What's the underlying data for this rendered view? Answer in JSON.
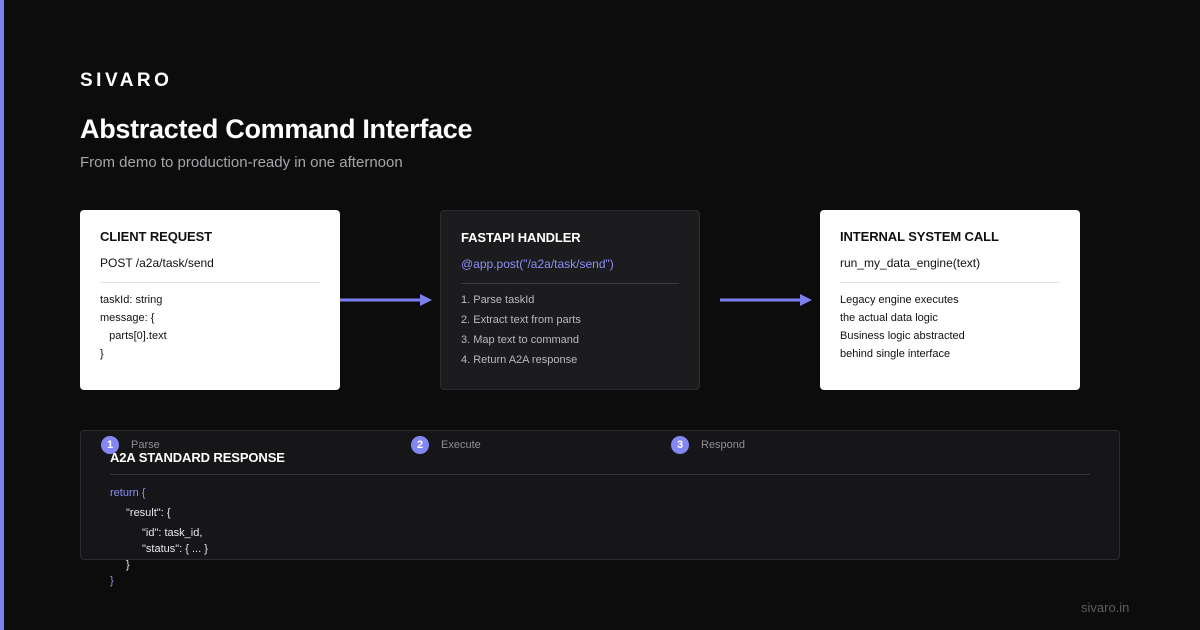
{
  "brand": "SIVARO",
  "title": "Abstracted Command Interface",
  "subtitle": "From demo to production-ready in one afternoon",
  "colors": {
    "accent": "#7b7ff0",
    "background": "#0c0c0d",
    "card_light": "#ffffff",
    "card_dark": "#1c1c1f"
  },
  "cards": [
    {
      "title": "CLIENT REQUEST",
      "sub": "POST /a2a/task/send",
      "lines": [
        "taskId: string",
        "message: {",
        "   parts[0].text",
        "}"
      ]
    },
    {
      "title": "FASTAPI HANDLER",
      "sub": "@app.post(\"/a2a/task/send\")",
      "lines": [
        "1. Parse taskId",
        "2. Extract text from parts",
        "3. Map text to command",
        "4. Return A2A response"
      ]
    },
    {
      "title": "INTERNAL SYSTEM CALL",
      "sub": "run_my_data_engine(text)",
      "lines": [
        "Legacy engine executes",
        "the actual data logic",
        "Business logic abstracted",
        "behind single interface"
      ]
    }
  ],
  "response": {
    "title": "A2A STANDARD RESPONSE",
    "code": [
      "return {",
      "\"result\": {",
      "\"id\": task_id,",
      "\"status\": { ... }",
      "}",
      "}"
    ]
  },
  "steps": [
    {
      "num": "1",
      "label": "Parse"
    },
    {
      "num": "2",
      "label": "Execute"
    },
    {
      "num": "3",
      "label": "Respond"
    }
  ],
  "footer": "sivaro.in"
}
